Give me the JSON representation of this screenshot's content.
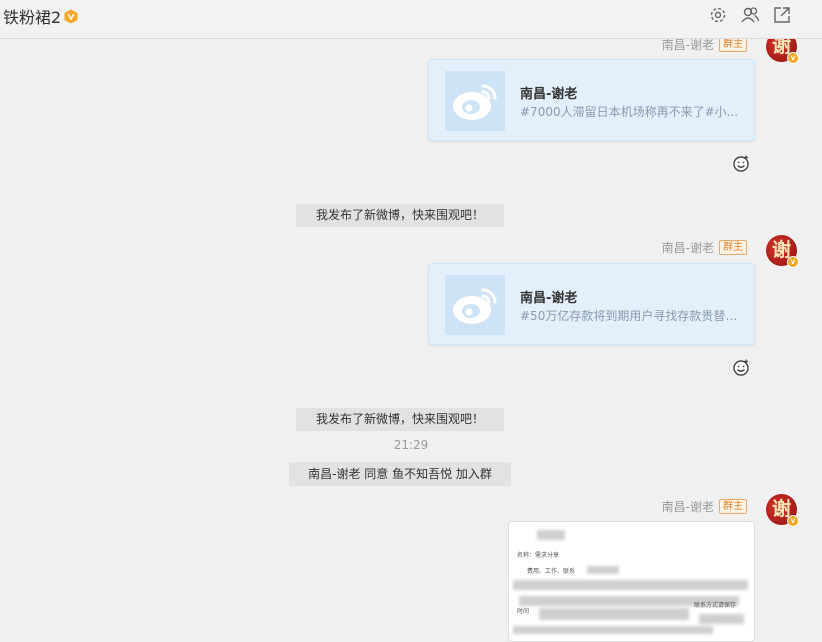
{
  "header": {
    "title": "铁粉裙2",
    "vip_icon": "vip-badge-icon",
    "actions": [
      {
        "name": "settings-icon"
      },
      {
        "name": "members-icon"
      },
      {
        "name": "popout-icon"
      }
    ]
  },
  "messages": {
    "sender": "南昌-谢老",
    "role_badge": "群主",
    "avatar_char": "谢",
    "card1": {
      "title": "南昌-谢老",
      "desc": "#7000人滞留日本机场称再不来了#小..."
    },
    "card2": {
      "title": "南昌-谢老",
      "desc": "#50万亿存款将到期用户寻找存款贵替#..."
    },
    "system1": "我发布了新微博，快来围观吧！",
    "system2": "我发布了新微博，快来围观吧！",
    "timestamp": "21:29",
    "join_notice": "南昌-谢老 同意 鱼不知吾悦 加入群",
    "image_snippet": {
      "line1": "名称：需求分享",
      "line2": "费用、工作、联系",
      "line3": "时间",
      "line4": "联系方式请保存"
    }
  },
  "colors": {
    "card_bg": "#e3f0fb",
    "badge_orange": "#e8822a",
    "avatar_red": "#c8201b"
  }
}
